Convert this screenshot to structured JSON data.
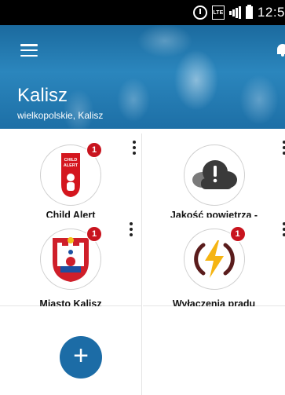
{
  "status_bar": {
    "clock": "12:5",
    "lte_label": "LTE"
  },
  "header": {
    "city": "Kalisz",
    "region": "wielkopolskie, Kalisz"
  },
  "tiles": [
    {
      "label": "Child Alert",
      "badge": "1",
      "icon": "child-alert-icon",
      "icon_text": "CHILD ALERT"
    },
    {
      "label": "Jakość powietrza - wielkopolskie",
      "badge": "",
      "icon": "cloud-alert-icon"
    },
    {
      "label": "Miasto Kalisz",
      "badge": "1",
      "icon": "kalisz-coat-of-arms-icon"
    },
    {
      "label": "Wyłączenia prądu",
      "badge": "1",
      "icon": "lightning-icon"
    }
  ],
  "add_button": {
    "label": "+"
  },
  "colors": {
    "header": "#1d6fa6",
    "badge": "#c8141e",
    "add_button": "#1c6ca6",
    "child_alert_red": "#d4161e",
    "lightning_yellow": "#f5b412"
  }
}
